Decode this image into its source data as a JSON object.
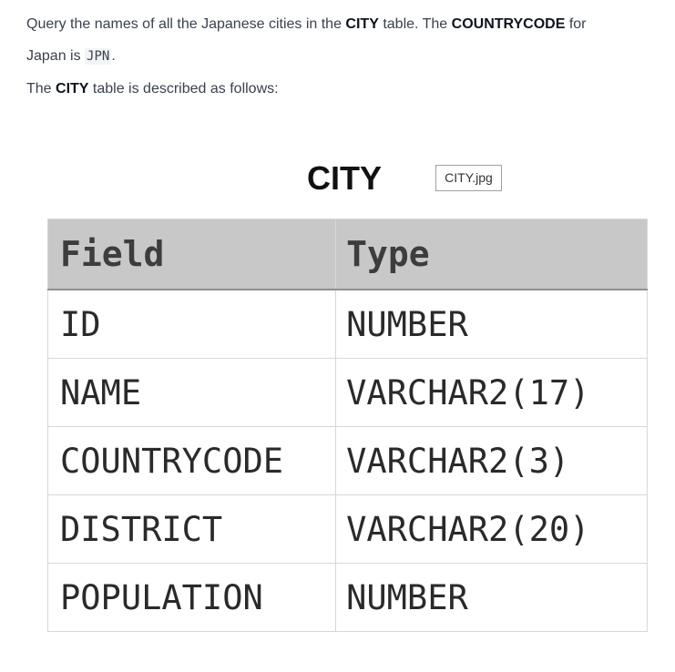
{
  "problem": {
    "line1_pre": "Query the names of all the Japanese cities in the ",
    "line1_table": "CITY",
    "line1_mid": " table. The ",
    "line1_col": "COUNTRYCODE",
    "line1_post": " for",
    "line2_pre": "Japan is ",
    "line2_code": "JPN",
    "line2_post": ".",
    "line3_pre": "The ",
    "line3_table": "CITY",
    "line3_post": " table is described as follows:"
  },
  "figure": {
    "title": "CITY",
    "image_alt": "CITY.jpg"
  },
  "table": {
    "headers": [
      "Field",
      "Type"
    ],
    "rows": [
      [
        "ID",
        "NUMBER"
      ],
      [
        "NAME",
        "VARCHAR2(17)"
      ],
      [
        "COUNTRYCODE",
        "VARCHAR2(3)"
      ],
      [
        "DISTRICT",
        "VARCHAR2(20)"
      ],
      [
        "POPULATION",
        "NUMBER"
      ]
    ]
  }
}
